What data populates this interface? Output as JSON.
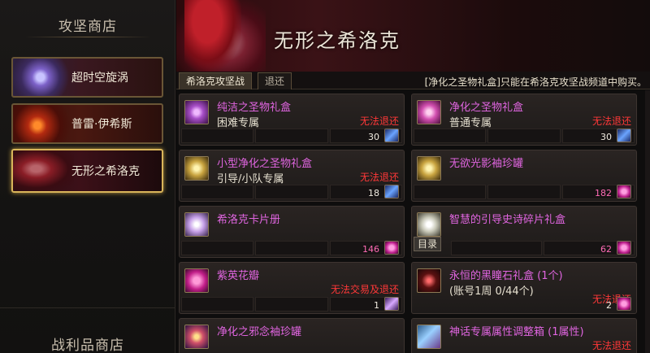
{
  "sidebar": {
    "title": "攻坚商店",
    "raids": [
      {
        "label": "超时空旋涡"
      },
      {
        "label": "普雷·伊希斯"
      },
      {
        "label": "无形之希洛克"
      }
    ],
    "title2": "战利品商店"
  },
  "header": {
    "boss_name": "无形之希洛克"
  },
  "tabs": [
    {
      "label": "希洛克攻坚战"
    },
    {
      "label": "退还"
    }
  ],
  "notice": "[净化之圣物礼盒]只能在希洛克攻坚战频道中购买。",
  "items": [
    {
      "name": "纯洁之圣物礼盒",
      "sub": "困难专属",
      "restrict": "无法退还",
      "price": "30",
      "currency": "feather-icon"
    },
    {
      "name": "净化之圣物礼盒",
      "sub": "普通专属",
      "restrict": "无法退还",
      "price": "30",
      "currency": "feather-icon"
    },
    {
      "name": "小型净化之圣物礼盒",
      "sub": "引导/小队专属",
      "restrict": "无法退还",
      "price": "18",
      "currency": "feather-icon"
    },
    {
      "name": "无欲光影袖珍罐",
      "sub": "",
      "restrict": "",
      "price": "182",
      "currency": "petal-icon"
    },
    {
      "name": "希洛克卡片册",
      "sub": "",
      "restrict": "",
      "price": "146",
      "currency": "petal-icon"
    },
    {
      "name": "智慧的引导史诗碎片礼盒",
      "sub": "",
      "restrict": "",
      "price": "62",
      "currency": "petal-icon",
      "badge": "目录"
    },
    {
      "name": "紫英花瓣",
      "sub": "",
      "restrict": "无法交易及退还",
      "price": "1",
      "currency": "quill-icon"
    },
    {
      "name": "永恒的黑瞳石礼盒 (1个)",
      "sub": "(账号1周 0/44个)",
      "restrict": "无法退还",
      "price": "2",
      "currency": "petal-icon"
    },
    {
      "name": "净化之邪念袖珍罐",
      "sub": "",
      "restrict": "",
      "price": "",
      "currency": ""
    },
    {
      "name": "神话专属属性调整箱 (1属性)",
      "sub": "",
      "restrict": "无法退还",
      "price": "",
      "currency": ""
    }
  ]
}
